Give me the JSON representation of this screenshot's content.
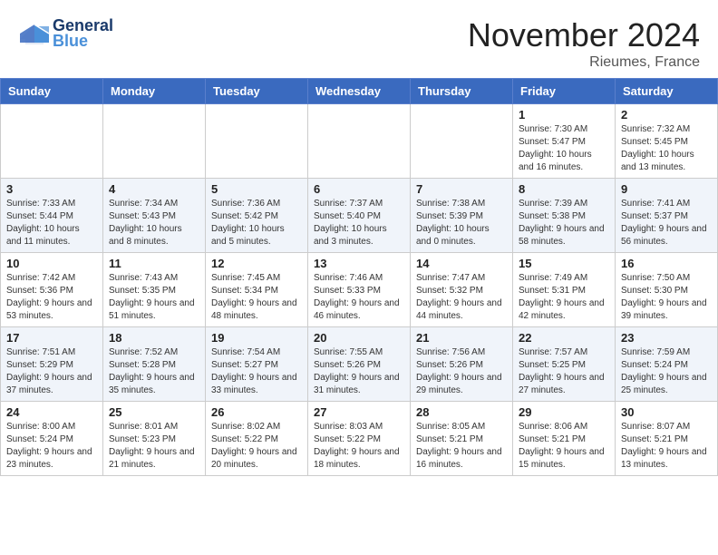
{
  "header": {
    "logo_line1": "General",
    "logo_line2": "Blue",
    "month": "November 2024",
    "location": "Rieumes, France"
  },
  "days_of_week": [
    "Sunday",
    "Monday",
    "Tuesday",
    "Wednesday",
    "Thursday",
    "Friday",
    "Saturday"
  ],
  "weeks": [
    [
      {
        "day": "",
        "info": ""
      },
      {
        "day": "",
        "info": ""
      },
      {
        "day": "",
        "info": ""
      },
      {
        "day": "",
        "info": ""
      },
      {
        "day": "",
        "info": ""
      },
      {
        "day": "1",
        "info": "Sunrise: 7:30 AM\nSunset: 5:47 PM\nDaylight: 10 hours and 16 minutes."
      },
      {
        "day": "2",
        "info": "Sunrise: 7:32 AM\nSunset: 5:45 PM\nDaylight: 10 hours and 13 minutes."
      }
    ],
    [
      {
        "day": "3",
        "info": "Sunrise: 7:33 AM\nSunset: 5:44 PM\nDaylight: 10 hours and 11 minutes."
      },
      {
        "day": "4",
        "info": "Sunrise: 7:34 AM\nSunset: 5:43 PM\nDaylight: 10 hours and 8 minutes."
      },
      {
        "day": "5",
        "info": "Sunrise: 7:36 AM\nSunset: 5:42 PM\nDaylight: 10 hours and 5 minutes."
      },
      {
        "day": "6",
        "info": "Sunrise: 7:37 AM\nSunset: 5:40 PM\nDaylight: 10 hours and 3 minutes."
      },
      {
        "day": "7",
        "info": "Sunrise: 7:38 AM\nSunset: 5:39 PM\nDaylight: 10 hours and 0 minutes."
      },
      {
        "day": "8",
        "info": "Sunrise: 7:39 AM\nSunset: 5:38 PM\nDaylight: 9 hours and 58 minutes."
      },
      {
        "day": "9",
        "info": "Sunrise: 7:41 AM\nSunset: 5:37 PM\nDaylight: 9 hours and 56 minutes."
      }
    ],
    [
      {
        "day": "10",
        "info": "Sunrise: 7:42 AM\nSunset: 5:36 PM\nDaylight: 9 hours and 53 minutes."
      },
      {
        "day": "11",
        "info": "Sunrise: 7:43 AM\nSunset: 5:35 PM\nDaylight: 9 hours and 51 minutes."
      },
      {
        "day": "12",
        "info": "Sunrise: 7:45 AM\nSunset: 5:34 PM\nDaylight: 9 hours and 48 minutes."
      },
      {
        "day": "13",
        "info": "Sunrise: 7:46 AM\nSunset: 5:33 PM\nDaylight: 9 hours and 46 minutes."
      },
      {
        "day": "14",
        "info": "Sunrise: 7:47 AM\nSunset: 5:32 PM\nDaylight: 9 hours and 44 minutes."
      },
      {
        "day": "15",
        "info": "Sunrise: 7:49 AM\nSunset: 5:31 PM\nDaylight: 9 hours and 42 minutes."
      },
      {
        "day": "16",
        "info": "Sunrise: 7:50 AM\nSunset: 5:30 PM\nDaylight: 9 hours and 39 minutes."
      }
    ],
    [
      {
        "day": "17",
        "info": "Sunrise: 7:51 AM\nSunset: 5:29 PM\nDaylight: 9 hours and 37 minutes."
      },
      {
        "day": "18",
        "info": "Sunrise: 7:52 AM\nSunset: 5:28 PM\nDaylight: 9 hours and 35 minutes."
      },
      {
        "day": "19",
        "info": "Sunrise: 7:54 AM\nSunset: 5:27 PM\nDaylight: 9 hours and 33 minutes."
      },
      {
        "day": "20",
        "info": "Sunrise: 7:55 AM\nSunset: 5:26 PM\nDaylight: 9 hours and 31 minutes."
      },
      {
        "day": "21",
        "info": "Sunrise: 7:56 AM\nSunset: 5:26 PM\nDaylight: 9 hours and 29 minutes."
      },
      {
        "day": "22",
        "info": "Sunrise: 7:57 AM\nSunset: 5:25 PM\nDaylight: 9 hours and 27 minutes."
      },
      {
        "day": "23",
        "info": "Sunrise: 7:59 AM\nSunset: 5:24 PM\nDaylight: 9 hours and 25 minutes."
      }
    ],
    [
      {
        "day": "24",
        "info": "Sunrise: 8:00 AM\nSunset: 5:24 PM\nDaylight: 9 hours and 23 minutes."
      },
      {
        "day": "25",
        "info": "Sunrise: 8:01 AM\nSunset: 5:23 PM\nDaylight: 9 hours and 21 minutes."
      },
      {
        "day": "26",
        "info": "Sunrise: 8:02 AM\nSunset: 5:22 PM\nDaylight: 9 hours and 20 minutes."
      },
      {
        "day": "27",
        "info": "Sunrise: 8:03 AM\nSunset: 5:22 PM\nDaylight: 9 hours and 18 minutes."
      },
      {
        "day": "28",
        "info": "Sunrise: 8:05 AM\nSunset: 5:21 PM\nDaylight: 9 hours and 16 minutes."
      },
      {
        "day": "29",
        "info": "Sunrise: 8:06 AM\nSunset: 5:21 PM\nDaylight: 9 hours and 15 minutes."
      },
      {
        "day": "30",
        "info": "Sunrise: 8:07 AM\nSunset: 5:21 PM\nDaylight: 9 hours and 13 minutes."
      }
    ]
  ]
}
